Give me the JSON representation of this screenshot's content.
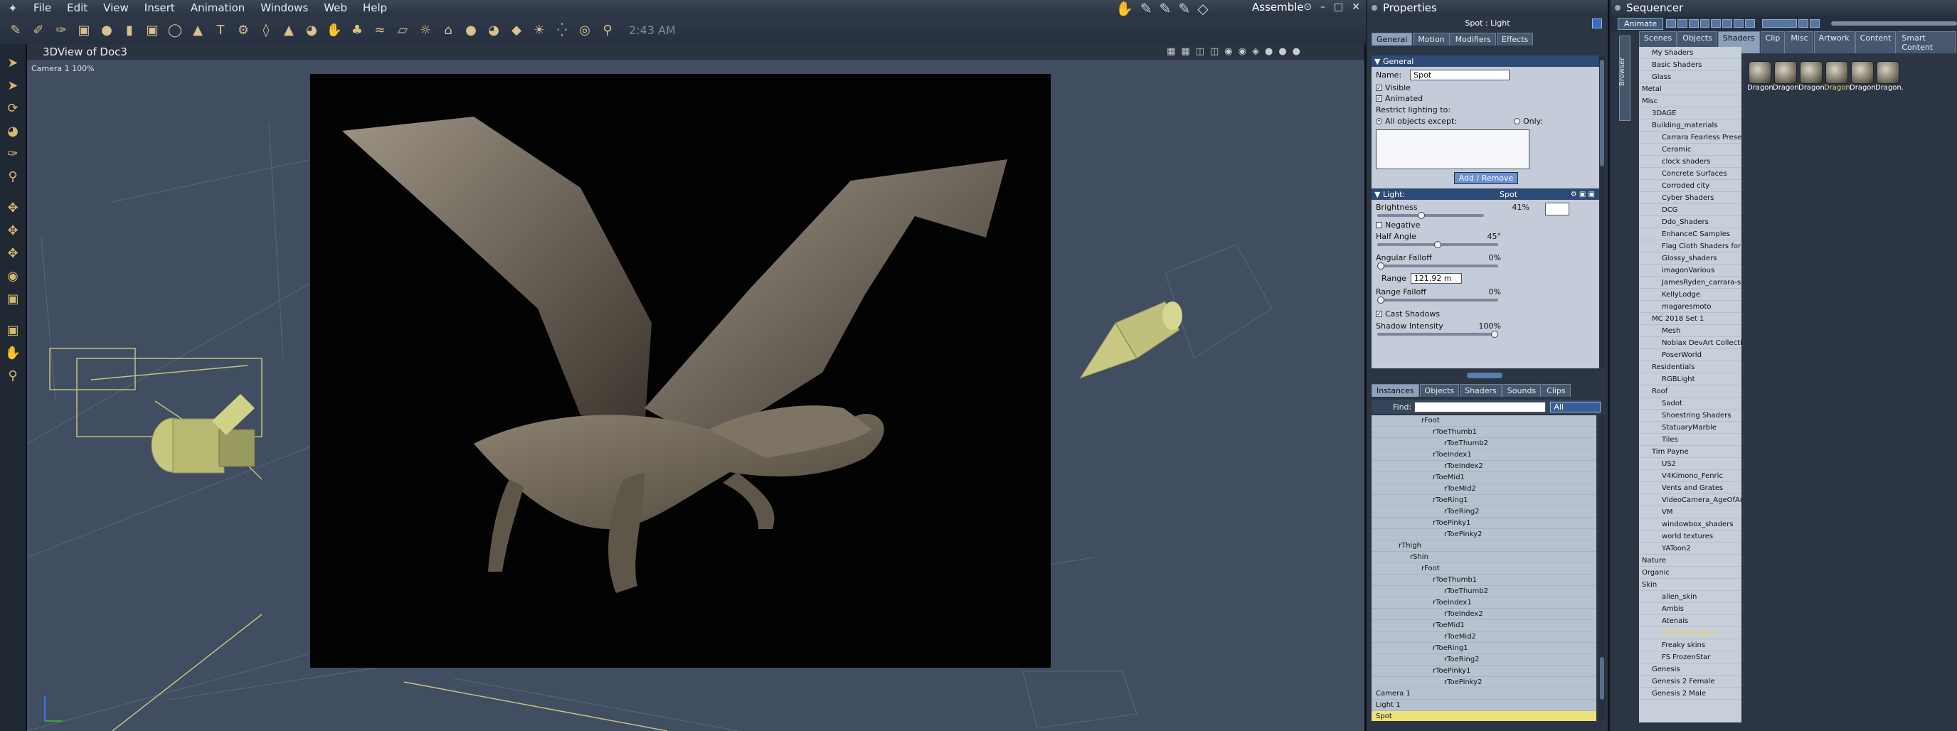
{
  "app": {
    "menu": [
      "File",
      "Edit",
      "View",
      "Insert",
      "Animation",
      "Windows",
      "Web",
      "Help"
    ],
    "room": "Assemble",
    "clock": "2:43 AM",
    "window_controls": [
      "⊙",
      "–",
      "□",
      "✕"
    ]
  },
  "viewport": {
    "title": "3DView of Doc3",
    "camera_label": "Camera 1 100%"
  },
  "properties": {
    "panel_title": "Properties",
    "object_label": "Spot : Light",
    "tabs": [
      "General",
      "Motion",
      "Modifiers",
      "Effects"
    ],
    "general": {
      "header": "General",
      "name_label": "Name:",
      "name_value": "Spot",
      "visible": "Visible",
      "animated": "Animated",
      "restrict": "Restrict lighting to:",
      "all_except": "All objects except:",
      "only": "Only:",
      "add_remove": "Add / Remove"
    },
    "light": {
      "header": "Light:",
      "type": "Spot",
      "brightness_label": "Brightness",
      "brightness_value": "41%",
      "brightness": 0.41,
      "negative": "Negative",
      "half_angle_label": "Half Angle",
      "half_angle_value": "45°",
      "half_angle": 0.5,
      "angular_falloff_label": "Angular Falloff",
      "angular_falloff_value": "0%",
      "angular_falloff": 0,
      "range_label": "Range",
      "range_value": "121.92 m",
      "range_falloff_label": "Range Falloff",
      "range_falloff_value": "0%",
      "range_falloff": 0,
      "cast_shadows": "Cast Shadows",
      "shadow_intensity_label": "Shadow Intensity",
      "shadow_intensity_value": "100%",
      "shadow_intensity": 1
    }
  },
  "browser": {
    "tabs": [
      "Instances",
      "Objects",
      "Shaders",
      "Sounds",
      "Clips"
    ],
    "find_label": "Find:",
    "find_filter": "All",
    "tree": [
      {
        "label": "rFoot",
        "indent": 4
      },
      {
        "label": "rToeThumb1",
        "indent": 5
      },
      {
        "label": "rToeThumb2",
        "indent": 6
      },
      {
        "label": "rToeIndex1",
        "indent": 5
      },
      {
        "label": "rToeIndex2",
        "indent": 6
      },
      {
        "label": "rToeMid1",
        "indent": 5
      },
      {
        "label": "rToeMid2",
        "indent": 6
      },
      {
        "label": "rToeRing1",
        "indent": 5
      },
      {
        "label": "rToeRing2",
        "indent": 6
      },
      {
        "label": "rToePinky1",
        "indent": 5
      },
      {
        "label": "rToePinky2",
        "indent": 6
      },
      {
        "label": "rThigh",
        "indent": 2
      },
      {
        "label": "rShin",
        "indent": 3
      },
      {
        "label": "rFoot",
        "indent": 4
      },
      {
        "label": "rToeThumb1",
        "indent": 5
      },
      {
        "label": "rToeThumb2",
        "indent": 6
      },
      {
        "label": "rToeIndex1",
        "indent": 5
      },
      {
        "label": "rToeIndex2",
        "indent": 6
      },
      {
        "label": "rToeMid1",
        "indent": 5
      },
      {
        "label": "rToeMid2",
        "indent": 6
      },
      {
        "label": "rToeRing1",
        "indent": 5
      },
      {
        "label": "rToeRing2",
        "indent": 6
      },
      {
        "label": "rToePinky1",
        "indent": 5
      },
      {
        "label": "rToePinky2",
        "indent": 6
      },
      {
        "label": "Camera 1",
        "indent": 0
      },
      {
        "label": "Light 1",
        "indent": 0
      },
      {
        "label": "Spot",
        "indent": 0,
        "selected": true
      }
    ]
  },
  "sequencer": {
    "title": "Sequencer",
    "animate": "Animate",
    "side_tab": "Browser",
    "tabs": [
      "Scenes",
      "Objects",
      "Shaders",
      "Clip",
      "Misc",
      "Artwork",
      "Content",
      "Smart Content"
    ],
    "tree": [
      {
        "label": "My Shaders",
        "indent": 1
      },
      {
        "label": "Basic Shaders",
        "indent": 1
      },
      {
        "label": "Glass",
        "indent": 1
      },
      {
        "label": "Metal",
        "indent": 0
      },
      {
        "label": "Misc",
        "indent": 0
      },
      {
        "label": "3DAGE",
        "indent": 1
      },
      {
        "label": "Building_materials",
        "indent": 1
      },
      {
        "label": "Carrara Fearless Presets",
        "indent": 2
      },
      {
        "label": "Ceramic",
        "indent": 2
      },
      {
        "label": "clock shaders",
        "indent": 2
      },
      {
        "label": "Concrete Surfaces",
        "indent": 2
      },
      {
        "label": "Corroded city",
        "indent": 2
      },
      {
        "label": "Cyber Shaders",
        "indent": 2
      },
      {
        "label": "DCG",
        "indent": 2
      },
      {
        "label": "Ddo_Shaders",
        "indent": 2
      },
      {
        "label": "EnhanceC Samples",
        "indent": 2
      },
      {
        "label": "Flag Cloth Shaders for Carr",
        "indent": 2
      },
      {
        "label": "Glossy_shaders",
        "indent": 2
      },
      {
        "label": "imagonVarious",
        "indent": 2
      },
      {
        "label": "JamesRyden_carrara-satin",
        "indent": 2
      },
      {
        "label": "KellyLodge",
        "indent": 2
      },
      {
        "label": "magaresmoto",
        "indent": 2
      },
      {
        "label": "MC 2018 Set 1",
        "indent": 1
      },
      {
        "label": "Mesh",
        "indent": 2
      },
      {
        "label": "Nobiax DevArt Collection",
        "indent": 2
      },
      {
        "label": "PoserWorld",
        "indent": 2
      },
      {
        "label": "Residentials",
        "indent": 1
      },
      {
        "label": "RGBLight",
        "indent": 2
      },
      {
        "label": "Roof",
        "indent": 1
      },
      {
        "label": "Sadot",
        "indent": 2
      },
      {
        "label": "Shoestring Shaders",
        "indent": 2
      },
      {
        "label": "StatuaryMarble",
        "indent": 2
      },
      {
        "label": "Tiles",
        "indent": 2
      },
      {
        "label": "Tim Payne",
        "indent": 1
      },
      {
        "label": "US2",
        "indent": 2
      },
      {
        "label": "V4Kimono_Fenric",
        "indent": 2
      },
      {
        "label": "Vents and Grates",
        "indent": 2
      },
      {
        "label": "VideoCamera_AgeOfArmor",
        "indent": 2
      },
      {
        "label": "VM",
        "indent": 2
      },
      {
        "label": "windowbox_shaders",
        "indent": 2
      },
      {
        "label": "world textures",
        "indent": 2
      },
      {
        "label": "YAToon2",
        "indent": 2
      },
      {
        "label": "Nature",
        "indent": 0
      },
      {
        "label": "Organic",
        "indent": 0
      },
      {
        "label": "Skin",
        "indent": 0
      },
      {
        "label": "alien_skin",
        "indent": 2
      },
      {
        "label": "Ambis",
        "indent": 2
      },
      {
        "label": "Atenais",
        "indent": 2
      },
      {
        "label": "DP-DAZDragon3",
        "indent": 2,
        "selected": true
      },
      {
        "label": "Freaky skins",
        "indent": 2
      },
      {
        "label": "FS FrozenStar",
        "indent": 2
      },
      {
        "label": "Genesis",
        "indent": 1
      },
      {
        "label": "Genesis 2 Female",
        "indent": 1
      },
      {
        "label": "Genesis 2 Male",
        "indent": 1
      }
    ],
    "thumbs": [
      {
        "label": "Dragon."
      },
      {
        "label": "Dragon."
      },
      {
        "label": "Dragon."
      },
      {
        "label": "Dragon.",
        "selected": true
      },
      {
        "label": "Dragon."
      },
      {
        "label": "Dragon."
      }
    ]
  }
}
